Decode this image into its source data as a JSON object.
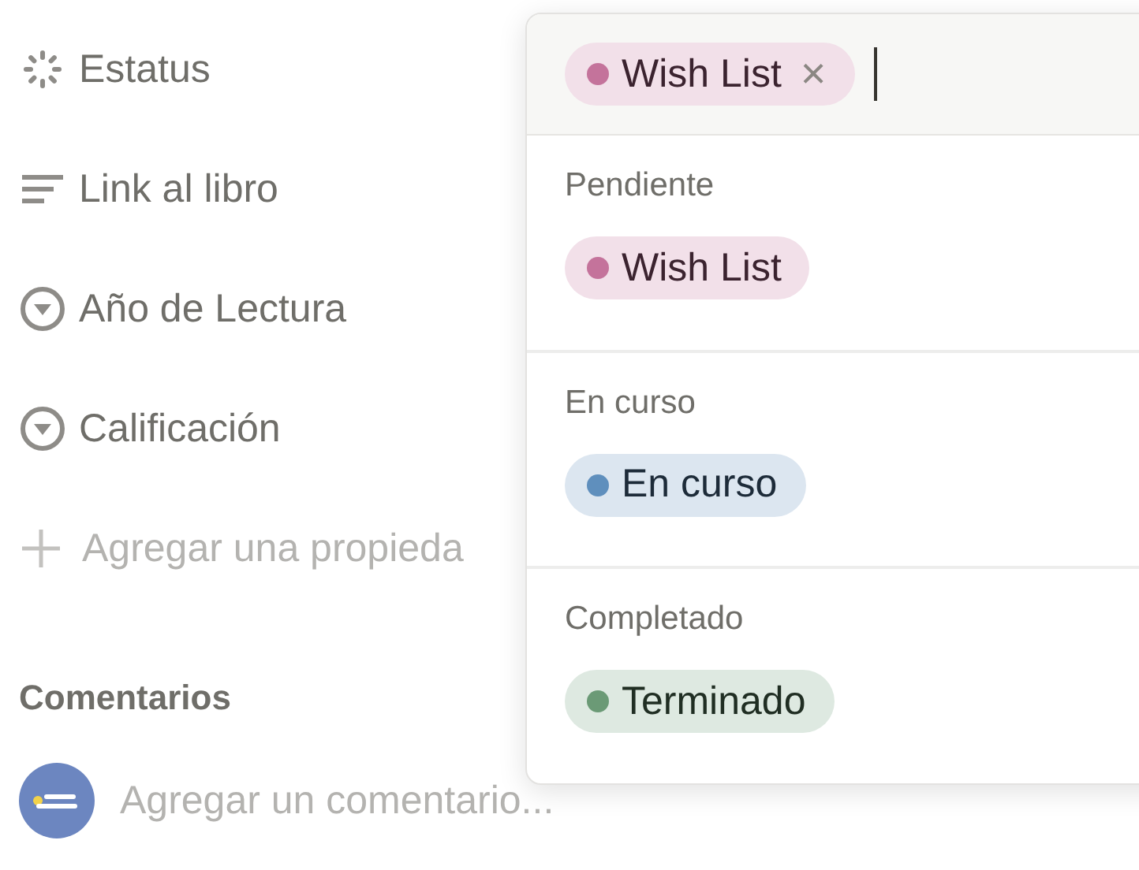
{
  "properties": [
    {
      "kind": "status",
      "label": "Estatus"
    },
    {
      "kind": "text",
      "label": "Link al libro"
    },
    {
      "kind": "select",
      "label": "Año de Lectura"
    },
    {
      "kind": "select",
      "label": "Calificación"
    }
  ],
  "add_property": "Agregar una propieda",
  "comments": {
    "title": "Comentarios",
    "placeholder": "Agregar un comentario..."
  },
  "status_picker": {
    "selected_tags": [
      {
        "label": "Wish List",
        "color": "#c4739b",
        "remove_icon": "×"
      }
    ],
    "groups": [
      {
        "title": "Pendiente",
        "options": [
          {
            "label": "Wish List",
            "color": "#c4739b"
          }
        ]
      },
      {
        "title": "En curso",
        "options": [
          {
            "label": "En curso",
            "color": "#5f8fbd"
          }
        ]
      },
      {
        "title": "Completado",
        "options": [
          {
            "label": "Terminado",
            "color": "#6b9a76"
          }
        ]
      }
    ]
  }
}
